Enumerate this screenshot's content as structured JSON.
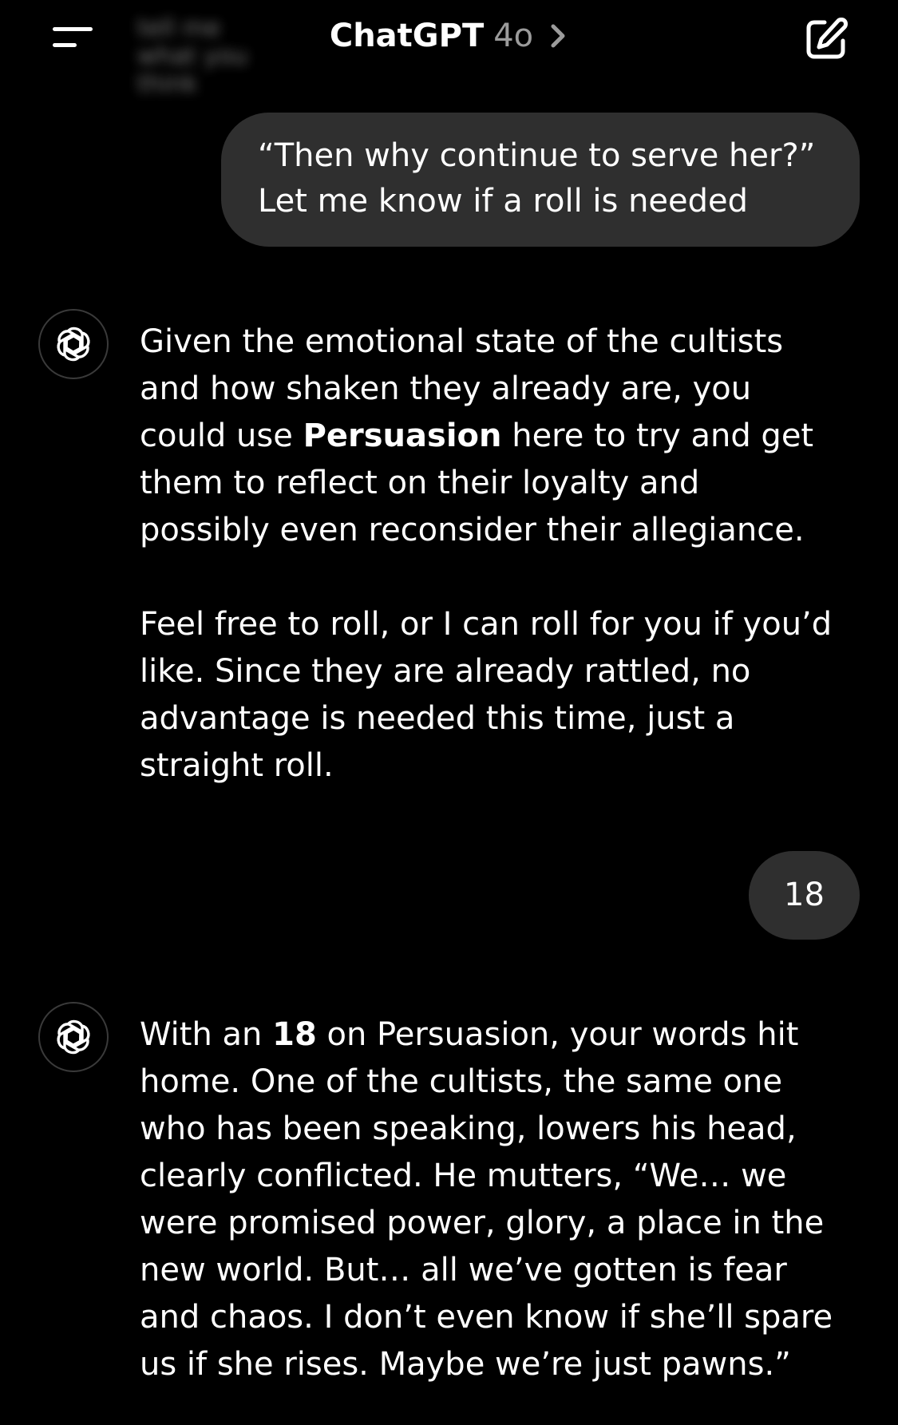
{
  "header": {
    "menu_icon": "hamburger-menu-icon",
    "blurred_previous_text": "tell me what you think",
    "app_name": "ChatGPT",
    "model_name": "4o",
    "chevron_icon": "chevron-right-icon",
    "new_chat_icon": "compose-icon"
  },
  "conversation": {
    "user_message_1": {
      "line_1": "“Then why continue to serve her?”",
      "line_2": "Let me know if a roll is needed"
    },
    "assistant_message_1": {
      "avatar_icon": "openai-logo-icon",
      "lines": [
        "Given the emotional state of the cultists",
        "and how shaken they already are, you",
        "could use ",
        "Persuasion",
        " here to try and get",
        "them to reflect on their loyalty and",
        "possibly even reconsider their allegiance.",
        "Feel free to roll, or I can roll for you if you’d",
        "like. Since they are already rattled, no",
        "advantage is needed this time, just a",
        "straight roll."
      ]
    },
    "user_message_2": {
      "text": "18"
    },
    "assistant_message_2": {
      "avatar_icon": "openai-logo-icon",
      "lines": [
        "With an ",
        "18",
        " on Persuasion, your words hit",
        "home. One of the cultists, the same one",
        "who has been speaking, lowers his head,",
        "clearly conflicted. He mutters, “We… we",
        "were promised power, glory, a place in the",
        "new world. But… all we’ve gotten is fear",
        "and chaos. I don’t even know if she’ll spare",
        "us if she rises. Maybe we’re just pawns.”"
      ]
    }
  },
  "colors": {
    "background": "#000000",
    "user_bubble": "#2f2f2f",
    "text": "#ffffff",
    "model_label": "#9b9b9b"
  }
}
